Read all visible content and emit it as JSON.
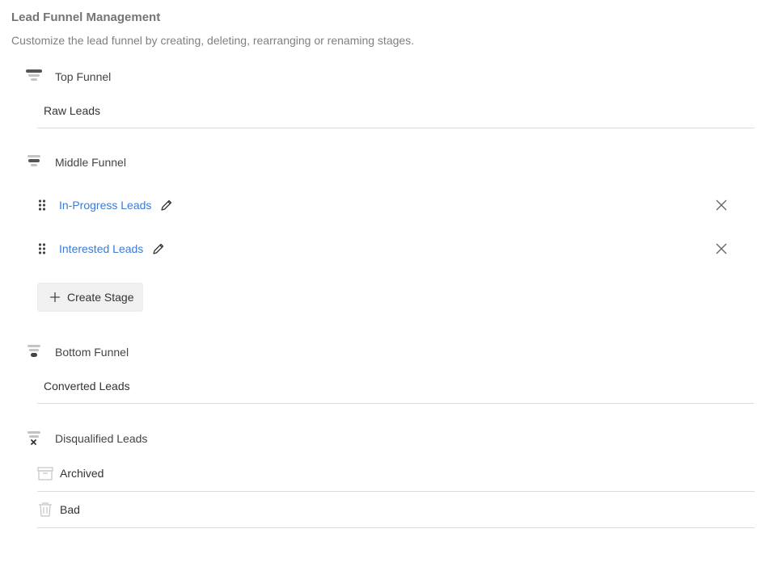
{
  "header": {
    "title": "Lead Funnel Management",
    "subtitle": "Customize the lead funnel by creating, deleting, rearranging or renaming stages."
  },
  "sections": {
    "top": {
      "title": "Top Funnel",
      "stage": "Raw Leads",
      "icon": "funnel-top-icon"
    },
    "middle": {
      "title": "Middle Funnel",
      "icon": "funnel-middle-icon",
      "stages": [
        {
          "label": "In-Progress Leads"
        },
        {
          "label": "Interested Leads"
        }
      ],
      "create_label": "Create Stage"
    },
    "bottom": {
      "title": "Bottom Funnel",
      "stage": "Converted Leads",
      "icon": "funnel-bottom-icon"
    },
    "disqualified": {
      "title": "Disqualified Leads",
      "icon": "funnel-disqualified-icon",
      "items": [
        {
          "label": "Archived",
          "icon": "archive-icon"
        },
        {
          "label": "Bad",
          "icon": "trash-icon"
        }
      ]
    }
  },
  "colors": {
    "link": "#3a7bd5",
    "icon_dark": "#555555",
    "icon_light": "#c4c4c4",
    "divider": "#dcdcdc"
  }
}
